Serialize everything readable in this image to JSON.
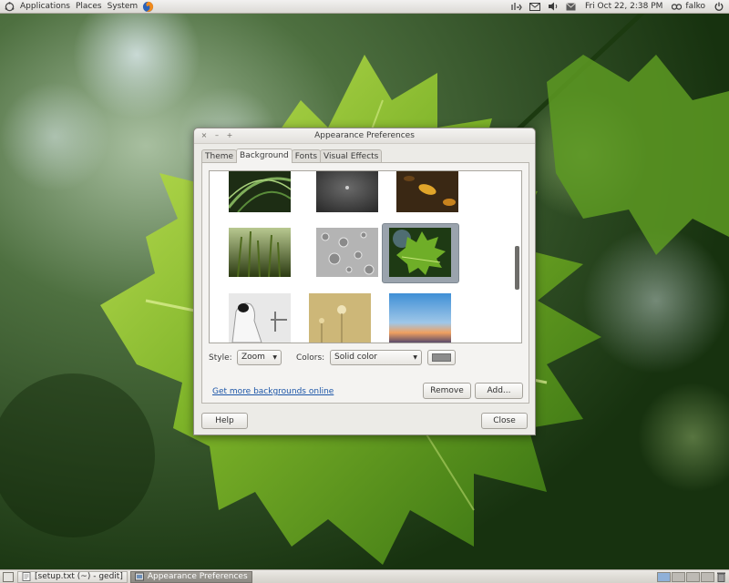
{
  "top_panel": {
    "menus": [
      "Applications",
      "Places",
      "System"
    ],
    "clock": "Fri Oct 22,  2:38 PM",
    "user": "falko"
  },
  "dialog": {
    "title": "Appearance Preferences",
    "tabs": [
      "Theme",
      "Background",
      "Fonts",
      "Visual Effects"
    ],
    "active_tab": "Background",
    "style_label": "Style:",
    "style_value": "Zoom",
    "colors_label": "Colors:",
    "colors_value": "Solid color",
    "color_swatch": "#8c8c8c",
    "link_text": "Get more backgrounds online",
    "remove_label": "Remove",
    "add_label": "Add...",
    "help_label": "Help",
    "close_label": "Close",
    "wallpapers": [
      "green-swirl",
      "dark-gray",
      "autumn-leaves",
      "grass",
      "water-drops",
      "green-leaf",
      "dog",
      "dandelion",
      "sunset-clouds"
    ],
    "selected_wallpaper": "green-leaf"
  },
  "taskbar": {
    "tasks": [
      {
        "label": "[setup.txt (~) - gedit]",
        "icon": "text-editor-icon"
      },
      {
        "label": "Appearance Preferences",
        "icon": "preferences-icon"
      }
    ],
    "active_task": "Appearance Preferences",
    "workspaces": 4
  },
  "colors": {
    "link": "#1c56a8",
    "selection": "#9aa3ad",
    "panel": "#dcdad5"
  }
}
